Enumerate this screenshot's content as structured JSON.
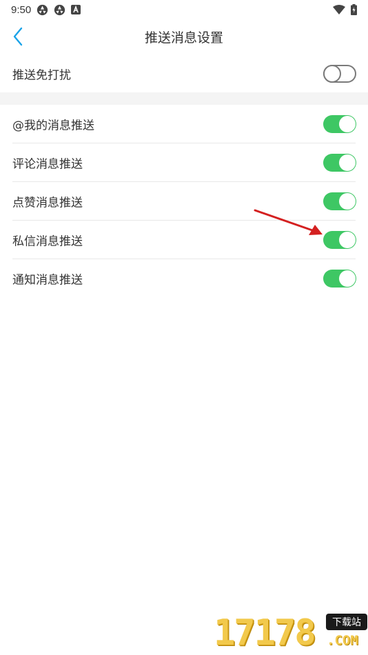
{
  "status_bar": {
    "time": "9:50",
    "left_icons": [
      "aperture-icon",
      "aperture-icon",
      "app-a-icon"
    ],
    "right_icons": [
      "wifi-icon",
      "battery-charging-icon"
    ]
  },
  "nav": {
    "title": "推送消息设置"
  },
  "dnd": {
    "label": "推送免打扰",
    "enabled": false
  },
  "settings": [
    {
      "label": "@我的消息推送",
      "enabled": true
    },
    {
      "label": "评论消息推送",
      "enabled": true
    },
    {
      "label": "点赞消息推送",
      "enabled": true
    },
    {
      "label": "私信消息推送",
      "enabled": true
    },
    {
      "label": "通知消息推送",
      "enabled": true
    }
  ],
  "colors": {
    "accent_back": "#1aa3e8",
    "toggle_on": "#3ec764",
    "toggle_off_border": "#7a7a7a",
    "annotation_arrow": "#d42020"
  },
  "watermark": {
    "number": "17178",
    "badge": "下载站",
    "suffix": ".COM"
  }
}
